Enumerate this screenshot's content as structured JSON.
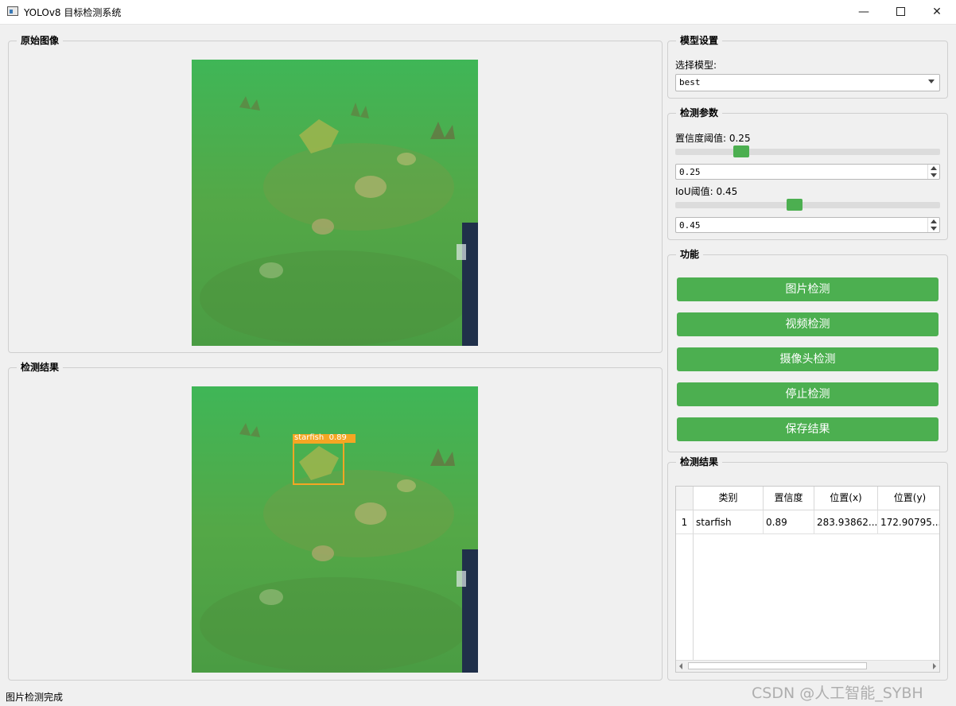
{
  "window": {
    "title": "YOLOv8 目标检测系统"
  },
  "original_panel": {
    "title": "原始图像"
  },
  "result_panel": {
    "title": "检测结果",
    "detection_label": "starfish  0.89"
  },
  "model_settings": {
    "title": "模型设置",
    "select_label": "选择模型:",
    "selected_model": "best"
  },
  "detection_params": {
    "title": "检测参数",
    "conf_label": "置信度阈值: 0.25",
    "conf_value": "0.25",
    "conf_slider_level": 0.25,
    "iou_label": "IoU阈值: 0.45",
    "iou_value": "0.45",
    "iou_slider_level": 0.45
  },
  "functions": {
    "title": "功能",
    "buttons": [
      "图片检测",
      "视频检测",
      "摄像头检测",
      "停止检测",
      "保存结果"
    ]
  },
  "results_table": {
    "title": "检测结果",
    "columns": [
      "类别",
      "置信度",
      "位置(x)",
      "位置(y)"
    ],
    "rows": [
      {
        "index": "1",
        "class": "starfish",
        "confidence": "0.89",
        "x": "283.93862...",
        "y": "172.90795..."
      }
    ]
  },
  "status_bar": {
    "text": "图片检测完成"
  },
  "watermark": {
    "text": "CSDN @人工智能_SYBH"
  },
  "colors": {
    "accent": "#4caf50",
    "bbox": "#f5a623"
  }
}
